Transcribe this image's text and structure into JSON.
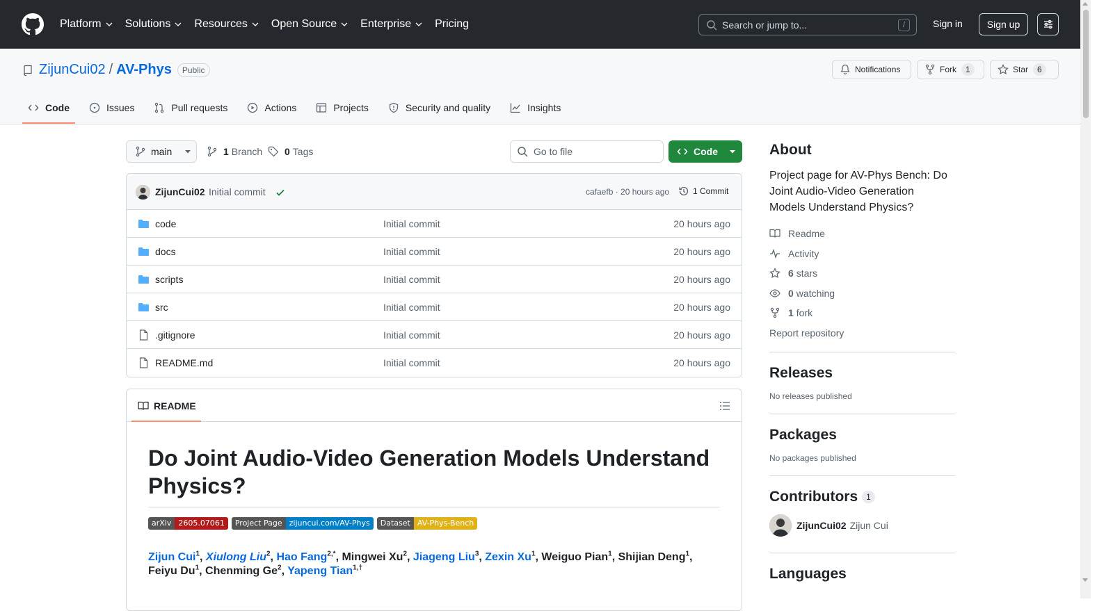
{
  "topnav": {
    "items": [
      "Platform",
      "Solutions",
      "Resources",
      "Open Source",
      "Enterprise",
      "Pricing"
    ],
    "search_placeholder": "Search or jump to...",
    "search_key": "/",
    "sign_in": "Sign in",
    "sign_up": "Sign up"
  },
  "repo": {
    "owner": "ZijunCui02",
    "separator": "/",
    "name": "AV-Phys",
    "visibility": "Public",
    "notifications_label": "Notifications",
    "fork_label": "Fork",
    "fork_count": "1",
    "star_label": "Star",
    "star_count": "6"
  },
  "tabs": [
    "Code",
    "Issues",
    "Pull requests",
    "Actions",
    "Projects",
    "Security and quality",
    "Insights"
  ],
  "branchbar": {
    "branch": "main",
    "branch_count": "1",
    "branch_label": "Branch",
    "tag_count": "0",
    "tag_label": "Tags",
    "goto_placeholder": "Go to file",
    "code_button": "Code"
  },
  "latest_commit": {
    "author": "ZijunCui02",
    "message": "Initial commit",
    "meta": "cafaefb · 20 hours ago",
    "count_label": "1 Commit"
  },
  "files": [
    {
      "name": "code",
      "type": "folder",
      "message": "Initial commit",
      "date": "20 hours ago"
    },
    {
      "name": "docs",
      "type": "folder",
      "message": "Initial commit",
      "date": "20 hours ago"
    },
    {
      "name": "scripts",
      "type": "folder",
      "message": "Initial commit",
      "date": "20 hours ago"
    },
    {
      "name": "src",
      "type": "folder",
      "message": "Initial commit",
      "date": "20 hours ago"
    },
    {
      "name": ".gitignore",
      "type": "file",
      "message": "Initial commit",
      "date": "20 hours ago"
    },
    {
      "name": "README.md",
      "type": "file",
      "message": "Initial commit",
      "date": "20 hours ago"
    }
  ],
  "readme": {
    "tab_label": "README",
    "title": "Do Joint Audio-Video Generation Models Understand Physics?",
    "badges": [
      {
        "left": "arXiv",
        "right": "2605.07061",
        "color": "#b31b1b"
      },
      {
        "left": "Project Page",
        "right": "zijuncui.com/AV-Phys",
        "color": "#007ec6"
      },
      {
        "left": "Dataset",
        "right": "AV-Phys-Bench",
        "color": "#dfb317"
      }
    ],
    "authors": [
      {
        "name": "Zijun Cui",
        "sup": "1",
        "link": true,
        "italic": false,
        "sep": ", "
      },
      {
        "name": "Xiulong Liu",
        "sup": "2",
        "link": true,
        "italic": true,
        "sep": ", "
      },
      {
        "name": "Hao Fang",
        "sup": "2,*",
        "link": true,
        "italic": false,
        "sep": ", "
      },
      {
        "name": "Mingwei Xu",
        "sup": "2",
        "link": false,
        "italic": false,
        "sep": ", "
      },
      {
        "name": "Jiageng Liu",
        "sup": "3",
        "link": true,
        "italic": false,
        "sep": ", "
      },
      {
        "name": "Zexin Xu",
        "sup": "1",
        "link": true,
        "italic": false,
        "sep": ", "
      },
      {
        "name": "Weiguo Pian",
        "sup": "1",
        "link": false,
        "italic": false,
        "sep": ", "
      },
      {
        "name": "Shijian Deng",
        "sup": "1",
        "link": false,
        "italic": false,
        "sep": ", "
      },
      {
        "name": "Feiyu Du",
        "sup": "1",
        "link": false,
        "italic": false,
        "sep": ", "
      },
      {
        "name": "Chenming Ge",
        "sup": "2",
        "link": false,
        "italic": false,
        "sep": ", "
      },
      {
        "name": "Yapeng Tian",
        "sup": "1,†",
        "link": true,
        "italic": false,
        "sep": ""
      }
    ]
  },
  "sidebar": {
    "about_title": "About",
    "description": "Project page for AV-Phys Bench: Do Joint Audio-Video Generation Models Understand Physics?",
    "readme_link": "Readme",
    "activity_link": "Activity",
    "stars_count": "6",
    "stars_label": "stars",
    "watching_count": "0",
    "watching_label": "watching",
    "fork_count": "1",
    "fork_label": "fork",
    "report": "Report repository",
    "releases_title": "Releases",
    "releases_empty": "No releases published",
    "packages_title": "Packages",
    "packages_empty": "No packages published",
    "contributors_title": "Contributors",
    "contributors_count": "1",
    "contributor_login": "ZijunCui02",
    "contributor_name": "Zijun Cui",
    "languages_title": "Languages"
  },
  "colors": {
    "header_bg": "#25292e",
    "link": "#0969da",
    "code_button": "#1f883d",
    "tab_underline": "#fd8c73",
    "folder": "#54aeff"
  }
}
